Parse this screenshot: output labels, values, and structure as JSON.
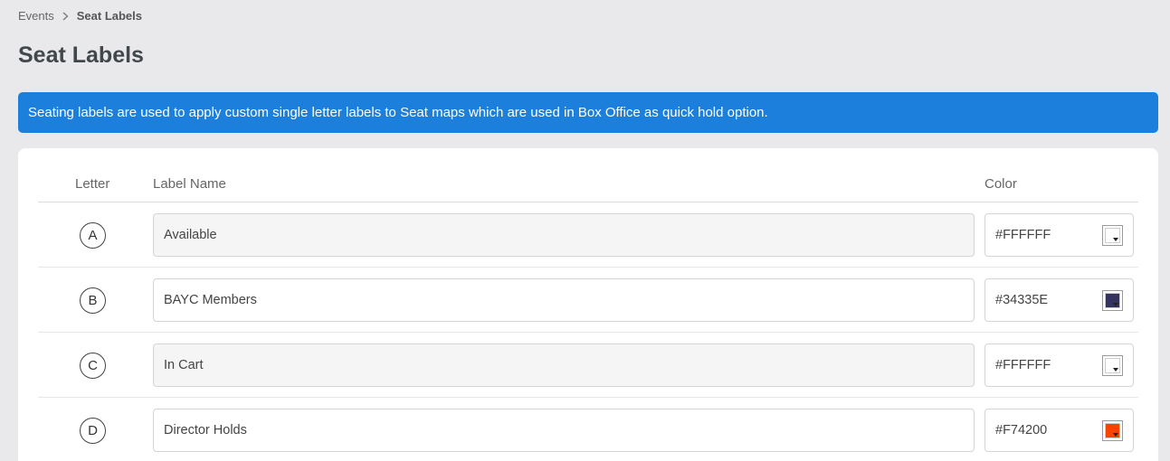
{
  "breadcrumb": {
    "parent": "Events",
    "current": "Seat Labels"
  },
  "page": {
    "title": "Seat Labels"
  },
  "banner": {
    "text": "Seating labels are used to apply custom single letter labels to Seat maps which are used in Box Office as quick hold option."
  },
  "table": {
    "headers": {
      "letter": "Letter",
      "name": "Label Name",
      "color": "Color"
    },
    "rows": [
      {
        "letter": "A",
        "name": "Available",
        "color": "#FFFFFF",
        "readonly": true
      },
      {
        "letter": "B",
        "name": "BAYC Members",
        "color": "#34335E",
        "readonly": false
      },
      {
        "letter": "C",
        "name": "In Cart",
        "color": "#FFFFFF",
        "readonly": true
      },
      {
        "letter": "D",
        "name": "Director Holds",
        "color": "#F74200",
        "readonly": false
      }
    ]
  },
  "colors": {
    "banner": "#1B7FDB",
    "background": "#E9E9EB",
    "card": "#FFFFFF"
  }
}
